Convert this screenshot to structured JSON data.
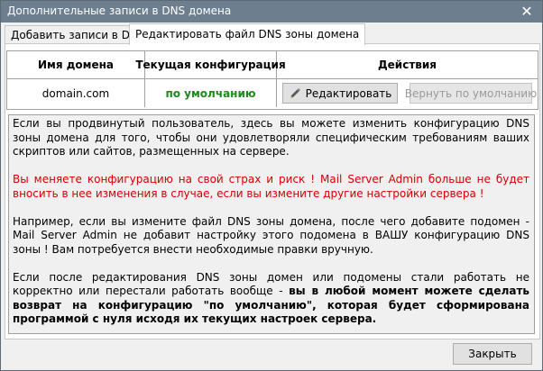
{
  "window": {
    "title": "Дополнительные записи в DNS домена",
    "close_glyph": "✕"
  },
  "tabs": [
    {
      "label": "Добавить записи в DNS",
      "active": false
    },
    {
      "label": "Редактировать файл DNS зоны домена",
      "active": true
    }
  ],
  "table": {
    "headers": [
      "Имя домена",
      "Текущая конфигурация",
      "Действия"
    ],
    "rows": [
      {
        "domain": "domain.com",
        "config": "по умолчанию",
        "edit_label": "Редактировать",
        "reset_label": "Вернуть по умолчанию"
      }
    ],
    "colors": {
      "config_status": "#1e8a1e"
    }
  },
  "info": {
    "p1": "Если вы продвинутый пользователь, здесь вы можете изменить конфигурацию DNS зоны домена для того, чтобы они удовлетворяли специфическим требованиям ваших скриптов или сайтов, размещенных на сервере.",
    "warning": "Вы меняете конфигурацию на свой страх и риск !  Mail Server Admin больше не будет вносить в нее изменения в случае, если вы измените другие настройки сервера !",
    "p3": "Например, если вы измените файл DNS зоны домена, после чего добавите подомен - Mail Server Admin не добавит настройку этого подомена в ВАШУ конфигурацию DNS зоны ! Вам потребуется внести необходимые правки вручную.",
    "p4_start": "Если после редактирования DNS зоны домен или подомены стали работать не корректно или перестали работать вообще - ",
    "p4_bold": "вы в любой момент можете сделать возврат на конфигурацию \"по умолчанию\", которая будет сформирована программой с нуля исходя их текущих настроек сервера.",
    "colors": {
      "warning": "#d40000"
    }
  },
  "footer": {
    "close_label": "Закрыть"
  },
  "icons": {
    "window_close": "close-icon",
    "edit": "pencil-icon"
  }
}
